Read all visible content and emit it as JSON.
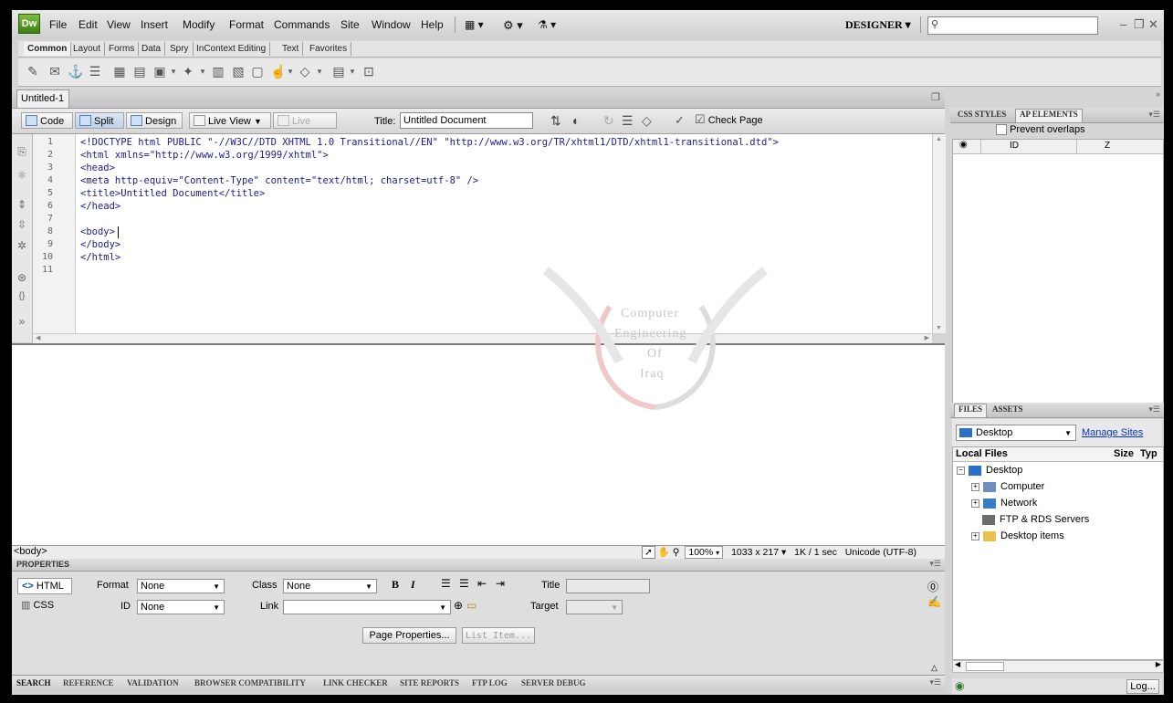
{
  "app": {
    "logo": "Dw"
  },
  "menu": [
    "File",
    "Edit",
    "View",
    "Insert",
    "Modify",
    "Format",
    "Commands",
    "Site",
    "Window",
    "Help"
  ],
  "workspace": "DESIGNER ▾",
  "insert_tabs": [
    "Common",
    "Layout",
    "Forms",
    "Data",
    "Spry",
    "InContext Editing",
    "Text",
    "Favorites"
  ],
  "doc_tab": "Untitled-1",
  "toolbar": {
    "code": "Code",
    "split": "Split",
    "design": "Design",
    "live_view": "Live View",
    "live_code": "Live Code",
    "title_label": "Title:",
    "title_value": "Untitled Document",
    "check_page": "Check Page"
  },
  "code_lines": [
    "<!DOCTYPE html PUBLIC \"-//W3C//DTD XHTML 1.0 Transitional//EN\" \"http://www.w3.org/TR/xhtml1/DTD/xhtml1-transitional.dtd\">",
    "<html xmlns=\"http://www.w3.org/1999/xhtml\">",
    "<head>",
    "<meta http-equiv=\"Content-Type\" content=\"text/html; charset=utf-8\" />",
    "<title>Untitled Document</title>",
    "</head>",
    "",
    "<body>",
    "</body>",
    "</html>",
    ""
  ],
  "line_numbers": [
    "1",
    "2",
    "3",
    "4",
    "5",
    "6",
    "7",
    "8",
    "9",
    "10",
    "11"
  ],
  "watermark": {
    "line1": "Computer",
    "line2": "Engineering",
    "line3": "Of",
    "line4": "Iraq"
  },
  "status": {
    "tag": "<body>",
    "zoom": "100%",
    "size": "1033 x 217 ▾",
    "weight": "1K / 1 sec",
    "encoding": "Unicode (UTF-8)"
  },
  "properties": {
    "header": "PROPERTIES",
    "html_btn": "HTML",
    "css_btn": "CSS",
    "format_label": "Format",
    "format_value": "None",
    "class_label": "Class",
    "class_value": "None",
    "id_label": "ID",
    "id_value": "None",
    "link_label": "Link",
    "title_label": "Title",
    "target_label": "Target",
    "page_props": "Page Properties...",
    "list_item": "List Item..."
  },
  "bottom_tabs": [
    "SEARCH",
    "REFERENCE",
    "VALIDATION",
    "BROWSER COMPATIBILITY",
    "LINK CHECKER",
    "SITE REPORTS",
    "FTP LOG",
    "SERVER DEBUG"
  ],
  "right": {
    "tab_css": "CSS STYLES",
    "tab_ap": "AP ELEMENTS",
    "prevent": "Prevent overlaps",
    "col_id": "ID",
    "col_z": "Z",
    "tab_files": "FILES",
    "tab_assets": "ASSETS",
    "site": "Desktop",
    "manage": "Manage Sites",
    "col_local": "Local Files",
    "col_size": "Size",
    "col_type": "Typ",
    "tree": [
      "Desktop",
      "Computer",
      "Network",
      "FTP & RDS Servers",
      "Desktop items"
    ],
    "log": "Log..."
  }
}
